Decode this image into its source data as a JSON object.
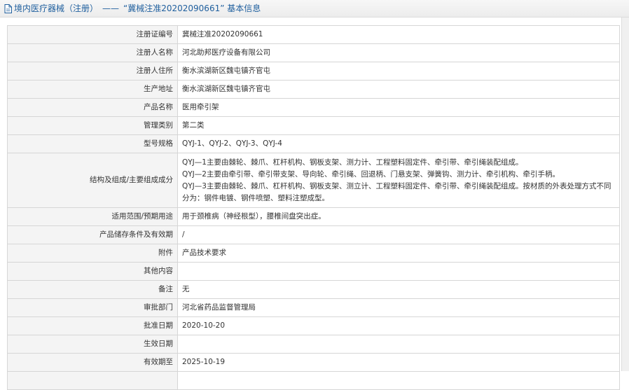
{
  "header": {
    "breadcrumb_root": "境内医疗器械（注册）",
    "separator": "——",
    "title": "“冀械注准20202090661” 基本信息"
  },
  "rows": [
    {
      "label": "注册证编号",
      "value": "冀械注准20202090661"
    },
    {
      "label": "注册人名称",
      "value": "河北助邦医疗设备有限公司"
    },
    {
      "label": "注册人住所",
      "value": "衡水滨湖新区魏屯镇齐官屯"
    },
    {
      "label": "生产地址",
      "value": "衡水滨湖新区魏屯镇齐官屯"
    },
    {
      "label": "产品名称",
      "value": "医用牵引架"
    },
    {
      "label": "管理类别",
      "value": "第二类"
    },
    {
      "label": "型号规格",
      "value": "QYJ-1、QYJ-2、QYJ-3、QYJ-4"
    },
    {
      "label": "结构及组成/主要组成成分",
      "value": "QYJ—1主要由棘轮、棘爪、杠杆机构、钢板支架、测力计、工程塑料固定件、牵引带、牵引绳装配组成。\nQYJ—2主要由牵引带、牵引带支架、导向轮、牵引绳、回退柄、门悬支架、弹簧钩、测力计、牵引机构、牵引手柄。\nQYJ—3主要由棘轮、棘爪、杠杆机构、钢板支架、测立计、工程塑料固定件、牵引带、牵引绳装配组成。按材质的外表处理方式不同分为：钢件电镀、钢件喷塑、塑料注塑成型。"
    },
    {
      "label": "适用范围/预期用途",
      "value": "用于颈椎病（神经根型），腰椎间盘突出症。"
    },
    {
      "label": "产品储存条件及有效期",
      "value": "/"
    },
    {
      "label": "附件",
      "value": "产品技术要求"
    },
    {
      "label": "其他内容",
      "value": ""
    },
    {
      "label": "备注",
      "value": "无"
    },
    {
      "label": "审批部门",
      "value": "河北省药品监督管理局"
    },
    {
      "label": "批准日期",
      "value": "2020-10-20"
    },
    {
      "label": "生效日期",
      "value": ""
    },
    {
      "label": "有效期至",
      "value": "2025-10-19"
    },
    {
      "label": "",
      "value": ""
    }
  ]
}
